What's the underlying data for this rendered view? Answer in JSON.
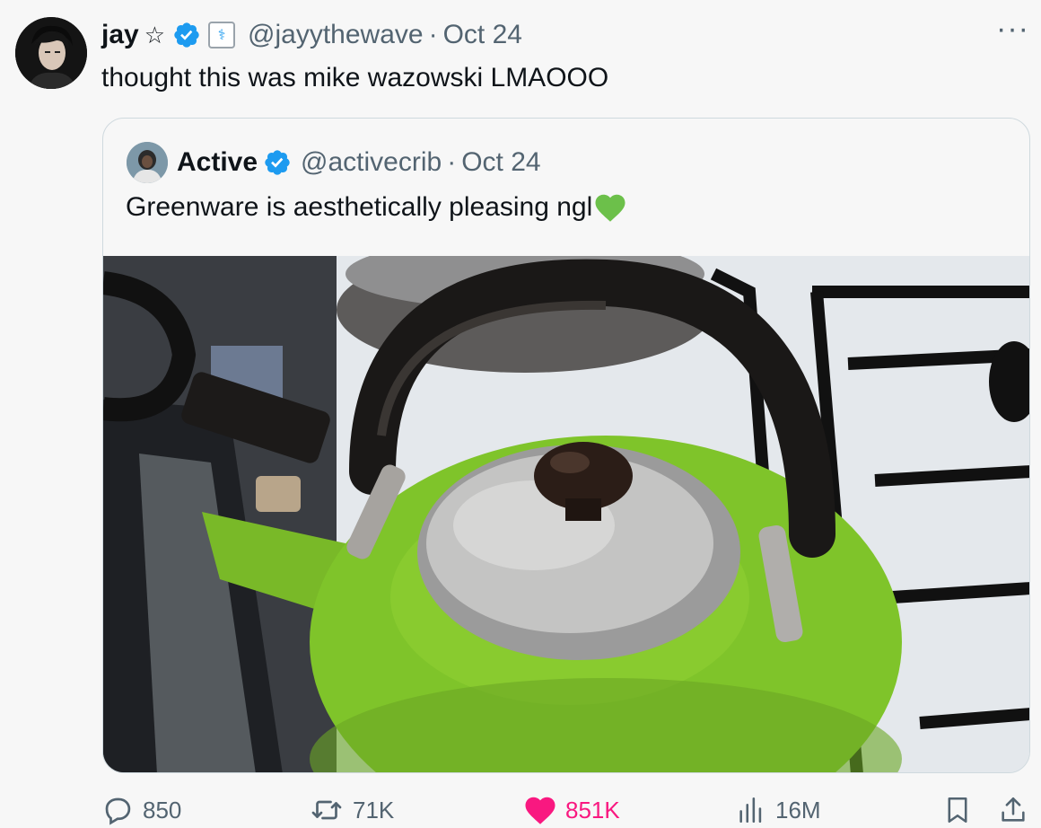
{
  "tweet": {
    "author_name": "jay",
    "name_star": "☆",
    "handle": "@jayythewave",
    "separator": "·",
    "date": "Oct 24",
    "text": "thought this was mike wazowski LMAOOO",
    "more": "···"
  },
  "quote": {
    "author_name": "Active",
    "handle": "@activecrib",
    "separator": "·",
    "date": "Oct 24",
    "text": "Greenware is aesthetically pleasing ngl",
    "text_emoji": "green-heart",
    "image_subject": "green kettle on stove"
  },
  "actions": {
    "replies": "850",
    "reposts": "71K",
    "likes": "851K",
    "views": "16M"
  },
  "colors": {
    "verified": "#1d9bf0",
    "like": "#f91880",
    "muted": "#536471",
    "kettle": "#7fc42a"
  }
}
